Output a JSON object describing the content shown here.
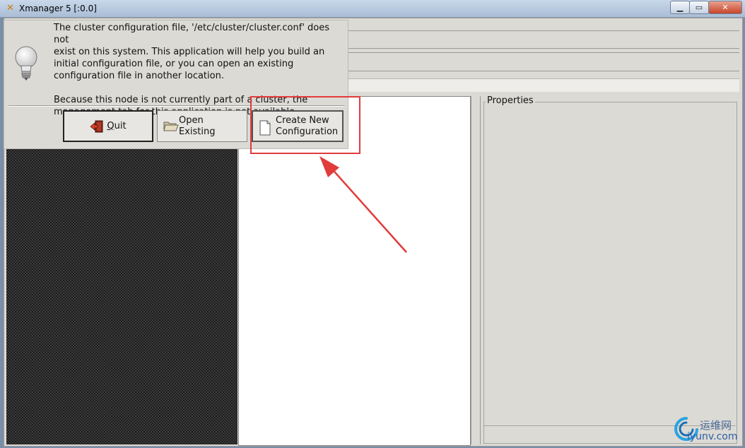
{
  "window": {
    "title": "Xmanager 5 [:0.0]",
    "app_icon": "x-icon",
    "controls": [
      "minimize-icon",
      "maximize-icon",
      "close-icon"
    ]
  },
  "dialog": {
    "icon": "lightbulb-icon",
    "message": "The cluster configuration file, '/etc/cluster/cluster.conf' does not\nexist on this system. This application will help you build an\ninitial configuration file, or you can open an existing\nconfiguration file in another location.\n\nBecause this node is not currently part of a cluster, the\nmanagement tab for this application is not available.",
    "buttons": {
      "quit": "Quit",
      "open_existing": "Open\nExisting",
      "create_new": "Create New\nConfiguration"
    }
  },
  "properties": {
    "label": "Properties"
  },
  "watermark": {
    "line1": "运维网",
    "line2": "iyunv.com"
  },
  "colors": {
    "highlight": "#e23b3b",
    "titlebar": "#b9cbe1"
  }
}
